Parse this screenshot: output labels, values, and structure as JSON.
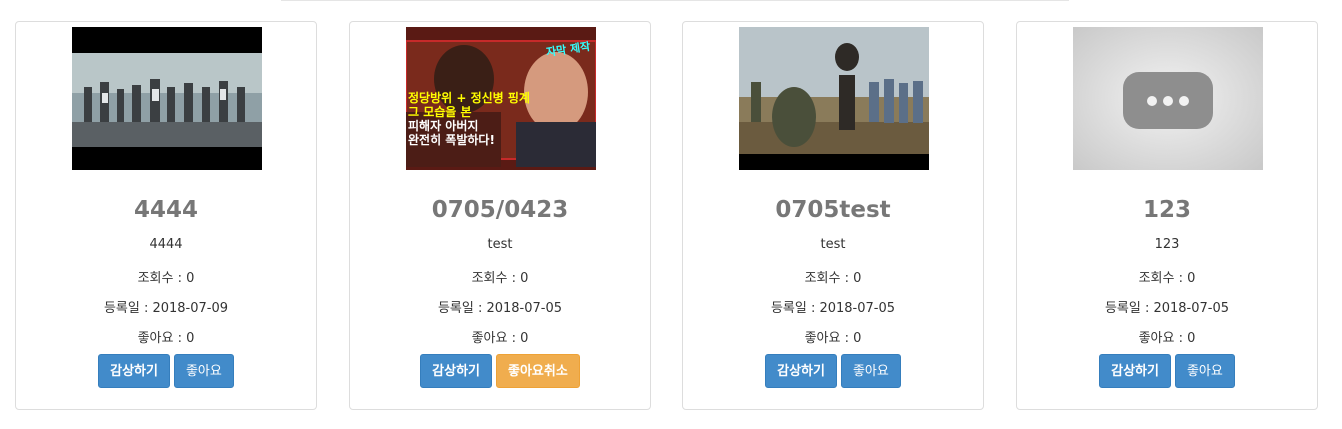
{
  "labels": {
    "views_prefix": "조회수 : ",
    "date_prefix": "등록일 : ",
    "likes_prefix": "좋아요 : "
  },
  "colors": {
    "primary": "#428bca",
    "warning": "#f0ad4e",
    "title": "#777777"
  },
  "cards": [
    {
      "thumbnail": "video-thumbnail-crowd",
      "title": "4444",
      "description": "4444",
      "views": "조회수 : 0",
      "date": "등록일 : 2018-07-09",
      "likes": "좋아요 : 0",
      "watch_label": "감상하기",
      "like_label": "좋아요",
      "like_state": "not-liked"
    },
    {
      "thumbnail": "video-thumbnail-court",
      "thumbnail_text": [
        "자막 제작",
        "정당방위 + 정신병 핑계",
        "그 모습을 본",
        "피해자 아버지",
        "완전히 폭발하다!"
      ],
      "title": "0705/0423",
      "description": "test",
      "views": "조회수 : 0",
      "date": "등록일 : 2018-07-05",
      "likes": "좋아요 : 0",
      "watch_label": "감상하기",
      "like_label": "좋아요취소",
      "like_state": "liked"
    },
    {
      "thumbnail": "video-thumbnail-field",
      "title": "0705test",
      "description": "test",
      "views": "조회수 : 0",
      "date": "등록일 : 2018-07-05",
      "likes": "좋아요 : 0",
      "watch_label": "감상하기",
      "like_label": "좋아요",
      "like_state": "not-liked"
    },
    {
      "thumbnail": "video-placeholder-icon",
      "title": "123",
      "description": "123",
      "views": "조회수 : 0",
      "date": "등록일 : 2018-07-05",
      "likes": "좋아요 : 0",
      "watch_label": "감상하기",
      "like_label": "좋아요",
      "like_state": "not-liked"
    }
  ]
}
